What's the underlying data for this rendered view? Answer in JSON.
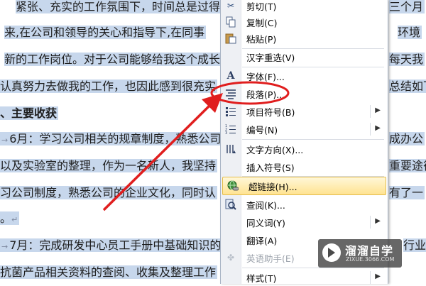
{
  "document": {
    "lines": [
      {
        "text": "紧张、充实的工作氛围下，时间总是过得",
        "bold": false
      },
      {
        "text": "来,在公司和领导的关心和指导下,在同事",
        "bold": false
      },
      {
        "text": "新的工作岗位。对于公司能够给我这个成长",
        "bold": false
      },
      {
        "text": "认真努力去做我的工作，也因此感到很充实",
        "bold": false
      },
      {
        "text": "主要收获",
        "bold": true,
        "prefix": "、"
      },
      {
        "text": "6月：学习公司相关的规章制度，熟悉公司",
        "bold": false
      },
      {
        "text": "以及实验室的整理，作为一名新人，我坚持",
        "bold": false
      },
      {
        "text": "习公司制度，熟悉公司的企业文化，同时认",
        "bold": false
      },
      {
        "text": "。",
        "bold": false
      },
      {
        "text": "7月：完成研发中心员工手册中基础知识的",
        "bold": false
      },
      {
        "text": "抗菌产品相关资料的查阅、收集及整理工作",
        "bold": false
      }
    ],
    "right_fragments": [
      "三个月",
      "环境",
      "每天我",
      "总结如下",
      "成办公",
      "重要途径",
      "有了一",
      "行业"
    ],
    "paragraph_mark": "↵",
    "line_arrow": "→"
  },
  "context_menu": {
    "items": [
      {
        "label": "剪切(T)",
        "icon": "scissors-icon",
        "type": "item"
      },
      {
        "label": "复制(C)",
        "icon": "copy-icon",
        "type": "item"
      },
      {
        "label": "粘贴(P)",
        "icon": "paste-icon",
        "type": "item"
      },
      {
        "type": "separator"
      },
      {
        "label": "汉字重选(V)",
        "icon": "",
        "type": "item"
      },
      {
        "type": "separator"
      },
      {
        "label": "字体(F)...",
        "icon": "font-icon",
        "type": "item"
      },
      {
        "label": "段落(P)...",
        "icon": "paragraph-icon",
        "type": "item",
        "circled": true
      },
      {
        "label": "项目符号(B)",
        "icon": "bullets-icon",
        "type": "submenu"
      },
      {
        "label": "编号(N)",
        "icon": "numbering-icon",
        "type": "submenu"
      },
      {
        "type": "separator"
      },
      {
        "label": "文字方向(X)...",
        "icon": "text-direction-icon",
        "type": "item"
      },
      {
        "label": "插入符号(S)",
        "icon": "",
        "type": "item"
      },
      {
        "type": "separator"
      },
      {
        "label": "超链接(H)...",
        "icon": "hyperlink-icon",
        "type": "item",
        "hover": true
      },
      {
        "label": "查阅(K)...",
        "icon": "lookup-icon",
        "type": "item"
      },
      {
        "label": "同义词(Y)",
        "icon": "",
        "type": "submenu"
      },
      {
        "label": "翻译(A)",
        "icon": "",
        "type": "item"
      },
      {
        "label": "英语助手(E)",
        "icon": "english-assistant-icon",
        "type": "item",
        "disabled": true
      },
      {
        "type": "separator"
      },
      {
        "label": "样式(T)",
        "icon": "",
        "type": "submenu"
      }
    ]
  },
  "annotation": {
    "color": "#e01e1e"
  },
  "watermark": {
    "brand": "溜溜自学",
    "site": "ZIXUE.3066.COM"
  }
}
